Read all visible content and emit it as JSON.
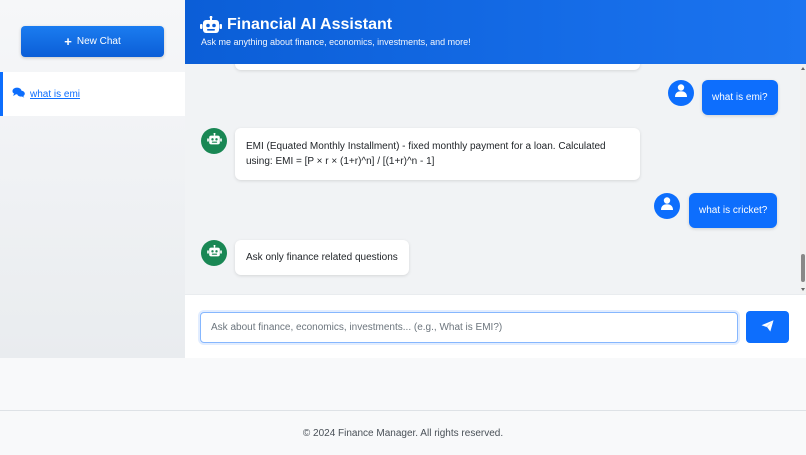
{
  "sidebar": {
    "new_chat_label": "New Chat",
    "history": [
      {
        "label": "what is emi"
      }
    ]
  },
  "header": {
    "title": "Financial AI Assistant",
    "subtitle": "Ask me anything about finance, economics, investments, and more!"
  },
  "messages": [
    {
      "role": "user",
      "text": "what is emi?"
    },
    {
      "role": "bot",
      "text": "EMI (Equated Monthly Installment) - fixed monthly payment for a loan. Calculated using: EMI = [P × r × (1+r)^n] / [(1+r)^n - 1]"
    },
    {
      "role": "user",
      "text": "what is cricket?"
    },
    {
      "role": "bot",
      "text": "Ask only finance related questions"
    }
  ],
  "input": {
    "placeholder": "Ask about finance, economics, investments... (e.g., What is EMI?)",
    "value": ""
  },
  "footer": {
    "text": "© 2024 Finance Manager. All rights reserved."
  },
  "colors": {
    "primary": "#0d6efd",
    "bot_avatar": "#198754",
    "header_gradient_start": "#0b5ed7",
    "header_gradient_end": "#1b74f0"
  },
  "icons": {
    "new_chat": "plus-icon",
    "history": "chat-bubbles-icon",
    "header": "robot-icon",
    "user_avatar": "user-icon",
    "bot_avatar": "robot-icon",
    "send": "paper-plane-icon"
  }
}
